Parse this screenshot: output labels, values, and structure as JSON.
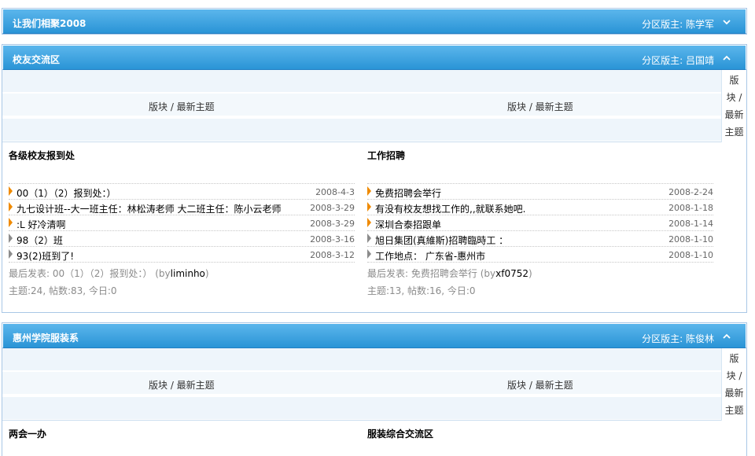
{
  "colors": {
    "bar_top": "#5bb6ec",
    "bar_bottom": "#2a94d6",
    "accent_arrow": "#ef8a00",
    "muted_text": "#8b8b8b"
  },
  "sections": [
    {
      "title": "让我们相聚2008",
      "moderator_label": "分区版主:",
      "moderator": "陈学军",
      "toggle_icon": "chevron-down-icon"
    },
    {
      "title": "校友交流区",
      "moderator_label": "分区版主:",
      "moderator": "吕国靖",
      "toggle_icon": "chevron-up-icon",
      "header": {
        "col1": "版块 / 最新主题",
        "col2": "版块 / 最新主题",
        "side": [
          "版",
          "块 /",
          "最新",
          "主题"
        ]
      },
      "forums": [
        {
          "name": "各级校友报到处",
          "topics": [
            {
              "title": "00（1）（2）报到处：）",
              "date": "2008-4-3",
              "arrow": "orange"
            },
            {
              "title": "九七设计班--大一班主任：林松涛老师 大二班主任：陈小云老师",
              "date": "2008-3-29",
              "arrow": "orange"
            },
            {
              "title": ":L 好冷清啊",
              "date": "2008-3-29",
              "arrow": "orange"
            },
            {
              "title": "98（2）班",
              "date": "2008-3-16",
              "arrow": "grey"
            },
            {
              "title": "93(2)班到了!",
              "date": "2008-3-12",
              "arrow": "grey"
            }
          ],
          "last_post_prefix": "最后发表:",
          "last_post_title": "00（1）（2）报到处：）",
          "last_post_by_open": "(by",
          "last_post_user": "liminho",
          "last_post_close": ")",
          "stats": "主题:24, 帖数:83, 今日:0"
        },
        {
          "name": "工作招聘",
          "topics": [
            {
              "title": "免费招聘会举行",
              "date": "2008-2-24",
              "arrow": "orange"
            },
            {
              "title": "有没有校友想找工作的,,就联系她吧.",
              "date": "2008-1-18",
              "arrow": "orange"
            },
            {
              "title": "深圳合泰招跟单",
              "date": "2008-1-14",
              "arrow": "orange"
            },
            {
              "title": "旭日集团(真維斯)招聘臨時工 ：",
              "date": "2008-1-10",
              "arrow": "grey"
            },
            {
              "title": "工作地点： 广东省-惠州市",
              "date": "2008-1-10",
              "arrow": "grey"
            }
          ],
          "last_post_prefix": "最后发表:",
          "last_post_title": "免费招聘会举行",
          "last_post_by_open": "(by",
          "last_post_user": "xf0752",
          "last_post_close": ")",
          "stats": "主题:13, 帖数:16, 今日:0"
        }
      ]
    },
    {
      "title": "惠州学院服装系",
      "moderator_label": "分区版主:",
      "moderator": "陈俊林",
      "toggle_icon": "chevron-up-icon",
      "header": {
        "col1": "版块 / 最新主题",
        "col2": "版块 / 最新主题",
        "side": [
          "版",
          "块 /",
          "最新",
          "主题"
        ]
      },
      "forums": [
        {
          "name": "两会一办"
        },
        {
          "name": "服装综合交流区"
        }
      ]
    }
  ]
}
